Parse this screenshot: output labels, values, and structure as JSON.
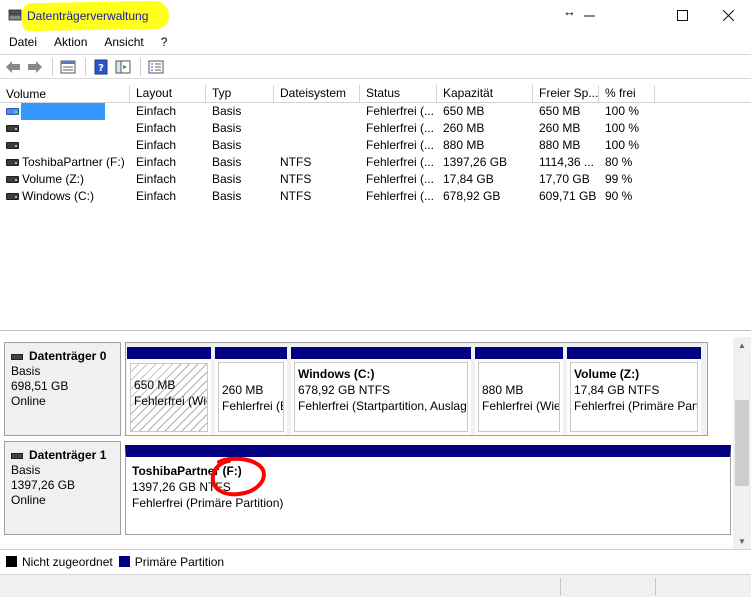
{
  "window": {
    "title": "Datenträgerverwaltung"
  },
  "menu": [
    "Datei",
    "Aktion",
    "Ansicht",
    "?"
  ],
  "toolbar_icons": [
    "back-arrow-icon",
    "forward-arrow-icon",
    "properties-icon",
    "help-icon",
    "console-tree-icon",
    "view-icon"
  ],
  "list": {
    "columns": [
      "Volume",
      "Layout",
      "Typ",
      "Dateisystem",
      "Status",
      "Kapazität",
      "Freier Sp...",
      "% frei"
    ],
    "rows": [
      {
        "volume": "",
        "layout": "Einfach",
        "type": "Basis",
        "fs": "",
        "status": "Fehlerfrei (...",
        "capacity": "650 MB",
        "free": "650 MB",
        "pct": "100 %"
      },
      {
        "volume": "",
        "layout": "Einfach",
        "type": "Basis",
        "fs": "",
        "status": "Fehlerfrei (...",
        "capacity": "260 MB",
        "free": "260 MB",
        "pct": "100 %"
      },
      {
        "volume": "",
        "layout": "Einfach",
        "type": "Basis",
        "fs": "",
        "status": "Fehlerfrei (...",
        "capacity": "880 MB",
        "free": "880 MB",
        "pct": "100 %"
      },
      {
        "volume": "ToshibaPartner (F:)",
        "layout": "Einfach",
        "type": "Basis",
        "fs": "NTFS",
        "status": "Fehlerfrei (...",
        "capacity": "1397,26 GB",
        "free": "1114,36 ...",
        "pct": "80 %"
      },
      {
        "volume": "Volume (Z:)",
        "layout": "Einfach",
        "type": "Basis",
        "fs": "NTFS",
        "status": "Fehlerfrei (...",
        "capacity": "17,84 GB",
        "free": "17,70 GB",
        "pct": "99 %"
      },
      {
        "volume": "Windows (C:)",
        "layout": "Einfach",
        "type": "Basis",
        "fs": "NTFS",
        "status": "Fehlerfrei (...",
        "capacity": "678,92 GB",
        "free": "609,71 GB",
        "pct": "90 %"
      }
    ]
  },
  "disks": [
    {
      "title": "Datenträger 0",
      "type": "Basis",
      "size": "698,51 GB",
      "state": "Online",
      "partitions": [
        {
          "name": "",
          "size": "650 MB",
          "status": "Fehlerfrei (Wie"
        },
        {
          "name": "",
          "size": "260 MB",
          "status": "Fehlerfrei (E"
        },
        {
          "name": "Windows  (C:)",
          "size": "678,92 GB NTFS",
          "status": "Fehlerfrei (Startpartition, Auslag"
        },
        {
          "name": "",
          "size": "880 MB",
          "status": "Fehlerfrei (Wie"
        },
        {
          "name": "Volume  (Z:)",
          "size": "17,84 GB NTFS",
          "status": "Fehlerfrei (Primäre Part"
        }
      ]
    },
    {
      "title": "Datenträger 1",
      "type": "Basis",
      "size": "1397,26 GB",
      "state": "Online",
      "partitions": [
        {
          "name": "ToshibaPartner  (F:)",
          "size": "1397,26 GB NTFS",
          "status": "Fehlerfrei (Primäre Partition)"
        }
      ]
    }
  ],
  "legend": [
    {
      "label": "Nicht zugeordnet",
      "color": "#000000"
    },
    {
      "label": "Primäre Partition",
      "color": "#000080"
    }
  ],
  "colors": {
    "title_highlight": "#ffff1c",
    "selection": "#3399ff",
    "primary_partition": "#000080",
    "annotation": "#ff0000"
  }
}
